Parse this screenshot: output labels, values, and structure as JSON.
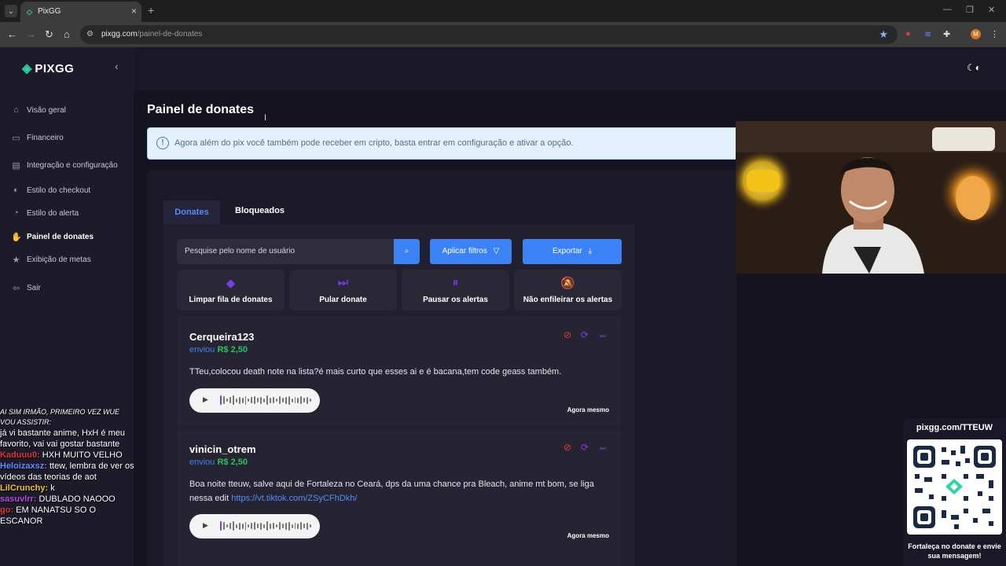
{
  "browser": {
    "tab_title": "PixGG",
    "url_host": "pixgg.com",
    "url_path": "/painel-de-donates",
    "profile_initial": "M"
  },
  "sidebar": {
    "logo_text": "PIXGG",
    "items": [
      {
        "label": "Visão geral",
        "icon": "home-icon"
      },
      {
        "label": "Financeiro",
        "icon": "wallet-icon"
      },
      {
        "label": "Integração e configuração",
        "icon": "settings-icon"
      },
      {
        "label": "Estilo do checkout",
        "icon": "palette-icon"
      },
      {
        "label": "Estilo do alerta",
        "icon": "brush-icon"
      },
      {
        "label": "Painel de donates",
        "icon": "donate-hand-icon"
      },
      {
        "label": "Exibição de metas",
        "icon": "star-icon"
      },
      {
        "label": "Sair",
        "icon": "logout-icon"
      }
    ],
    "active_index": 5
  },
  "page": {
    "title": "Painel de donates",
    "banner_text": "Agora além do pix você também pode receber em cripto, basta entrar em configuração e ativar a opção."
  },
  "tabs": {
    "donates": "Donates",
    "blocked": "Bloqueados"
  },
  "toolbar": {
    "search_placeholder": "Pesquise pelo nome de usuário",
    "filters_label": "Aplicar filtros",
    "export_label": "Exportar"
  },
  "actions": [
    {
      "label": "Limpar fila de donates",
      "icon": "eraser-icon"
    },
    {
      "label": "Pular donate",
      "icon": "skip-icon"
    },
    {
      "label": "Pausar os alertas",
      "icon": "pause-icon"
    },
    {
      "label": "Não enfileirar os alertas",
      "icon": "bell-off-icon"
    }
  ],
  "donates": [
    {
      "user": "Cerqueira123",
      "sent_label": "enviou",
      "amount": "R$ 2,50",
      "message": "TTeu,colocou death note na lista?é mais curto que esses ai e é bacana,tem code geass também.",
      "link": "",
      "time": "Agora mesmo"
    },
    {
      "user": "vinicin_otrem",
      "sent_label": "enviou",
      "amount": "R$ 2,50",
      "message": "Boa noite tteuw, salve aqui de Fortaleza no Ceará, dps da uma chance pra Bleach, anime mt bom, se liga nessa edit",
      "link": "https://vt.tiktok.com/ZSyCFhDkh/",
      "time": "Agora mesmo"
    }
  ],
  "chat": [
    {
      "user": "",
      "text": "AI SIM IRMÃO, PRIMEIRO VEZ WUE VOU ASSISTIR:",
      "color": "#ffffff"
    },
    {
      "user": "",
      "text": "já vi bastante anime, HxH é meu favorito, vai vai gostar bastante",
      "color": "#ffffff"
    },
    {
      "user": "Kaduuu0:",
      "text": "HXH MUITO VELHO",
      "color": "#e0343a"
    },
    {
      "user": "Heloizaxsz:",
      "text": "ttew, lembra de ver os vídeos das teorias de aot",
      "color": "#6b8cff"
    },
    {
      "user": "LilCrunchy:",
      "text": "k",
      "color": "#f2c12e"
    },
    {
      "user": "sasuvlrr:",
      "text": "DUBLADO NAOOO",
      "color": "#b44be0"
    },
    {
      "user": "go:",
      "text": "EM NANATSU SO O ESCANOR",
      "color": "#e0343a"
    }
  ],
  "qr": {
    "url": "pixgg.com/TTEUW",
    "caption": "Fortaleça no donate e envie sua mensagem!"
  },
  "colors": {
    "accent": "#3b82f6",
    "brand": "#2bd4a4",
    "amount": "#22c55e",
    "purple": "#7c3aed"
  }
}
